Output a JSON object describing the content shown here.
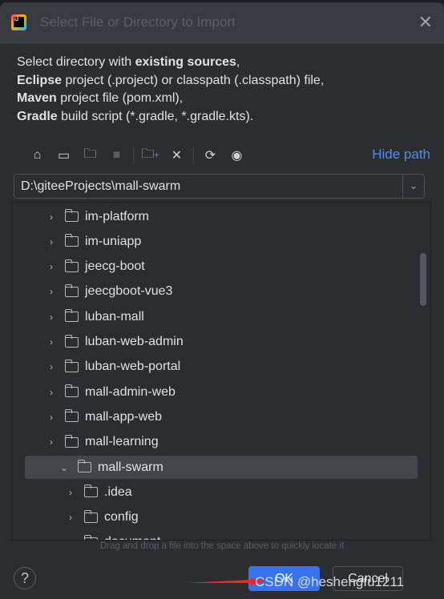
{
  "dialog": {
    "title": "Select File or Directory to Import",
    "logo_text": "IJ"
  },
  "description": {
    "line1_prefix": "Select directory with ",
    "line1_bold": "existing sources",
    ",": ",",
    "line2_bold": "Eclipse",
    "line2_rest": " project (.project) or classpath (.classpath) file,",
    "line3_bold": "Maven",
    "line3_rest": " project file (pom.xml),",
    "line4_bold": "Gradle",
    "line4_rest": " build script (*.gradle, *.gradle.kts)."
  },
  "toolbar": {
    "icons": [
      "home-icon",
      "desktop-icon",
      "project-folder-icon",
      "module-folder-icon",
      "new-folder-icon",
      "delete-icon",
      "refresh-icon",
      "show-hidden-icon"
    ],
    "hide_path": "Hide path"
  },
  "path": {
    "value": "D:\\giteeProjects\\mall-swarm"
  },
  "tree": [
    {
      "label": "im-platform",
      "level": 0,
      "expanded": false
    },
    {
      "label": "im-uniapp",
      "level": 0,
      "expanded": false
    },
    {
      "label": "jeecg-boot",
      "level": 0,
      "expanded": false
    },
    {
      "label": "jeecgboot-vue3",
      "level": 0,
      "expanded": false
    },
    {
      "label": "luban-mall",
      "level": 0,
      "expanded": false
    },
    {
      "label": "luban-web-admin",
      "level": 0,
      "expanded": false
    },
    {
      "label": "luban-web-portal",
      "level": 0,
      "expanded": false
    },
    {
      "label": "mall-admin-web",
      "level": 0,
      "expanded": false
    },
    {
      "label": "mall-app-web",
      "level": 0,
      "expanded": false
    },
    {
      "label": "mall-learning",
      "level": 0,
      "expanded": false
    },
    {
      "label": "mall-swarm",
      "level": 0,
      "expanded": true,
      "selected": true
    },
    {
      "label": ".idea",
      "level": 1,
      "expanded": false
    },
    {
      "label": "config",
      "level": 1,
      "expanded": false
    },
    {
      "label": "document",
      "level": 1,
      "expanded": false
    }
  ],
  "hint": "Drag and drop a file into the space above to quickly locate it",
  "buttons": {
    "help": "?",
    "ok": "OK",
    "cancel": "Cancel"
  },
  "watermark": "CSDN @heshengfu1211",
  "colors": {
    "accent": "#3574f0",
    "link": "#548af7",
    "background": "#2b2d30",
    "arrow": "#ff2020"
  }
}
